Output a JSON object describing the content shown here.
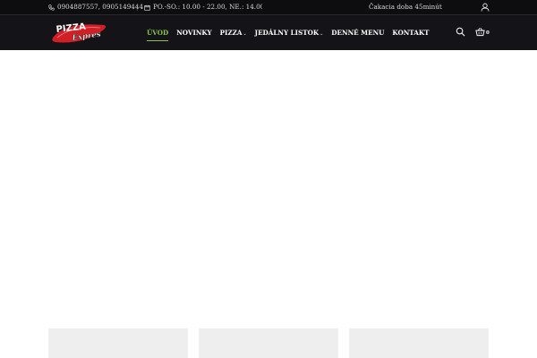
{
  "topbar": {
    "phone": "0904887557, 0905149444",
    "separator": "|",
    "hours": "PO.-SO.: 10.00 - 22.00, NE.: 14.00 - 22.00",
    "wait_time": "Čakacia doba 45minút",
    "phone_icon": "phone-icon",
    "hours_icon": "calendar-icon",
    "user_icon": "user-icon"
  },
  "logo": {
    "line1": "PIZZA",
    "line2": "Expres"
  },
  "nav": {
    "items": [
      {
        "label": "ÚVOD",
        "active": true,
        "dropdown": false
      },
      {
        "label": "NOVINKY",
        "active": false,
        "dropdown": false
      },
      {
        "label": "PIZZA",
        "active": false,
        "dropdown": true
      },
      {
        "label": "JEDÁLNY LISTOK",
        "active": false,
        "dropdown": true
      },
      {
        "label": "DENNÉ MENU",
        "active": false,
        "dropdown": false
      },
      {
        "label": "KONTAKT",
        "active": false,
        "dropdown": false
      }
    ],
    "caret": "⌄"
  },
  "actions": {
    "search_icon": "search-icon",
    "cart_icon": "basket-icon",
    "cart_count": "0"
  },
  "colors": {
    "topbar_bg": "#0d0d10",
    "nav_bg": "#141418",
    "accent": "#8bc34a",
    "logo_red": "#d21f26",
    "card_bg": "#eeeeee"
  }
}
